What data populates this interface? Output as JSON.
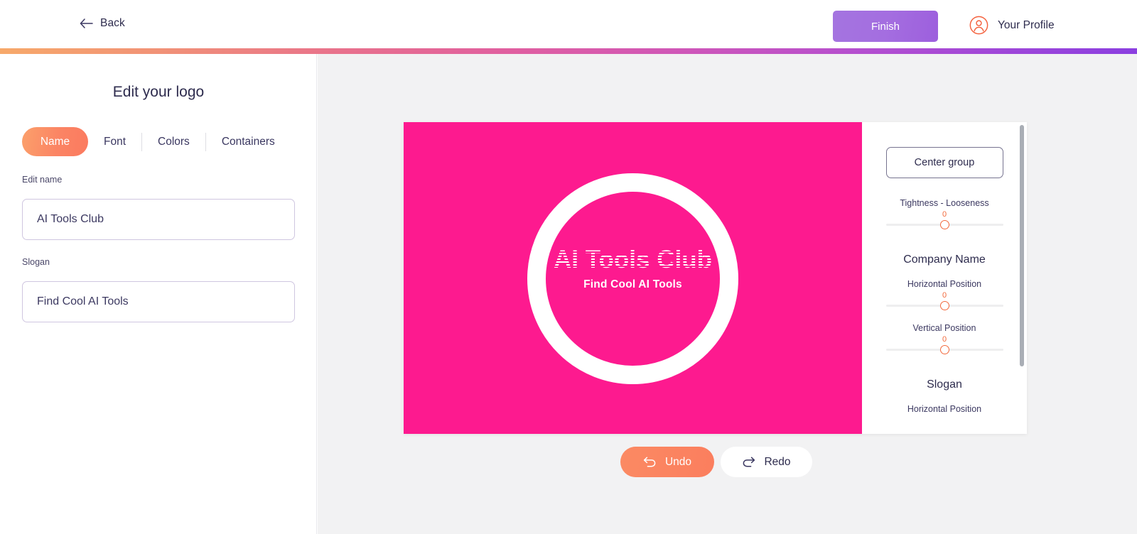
{
  "header": {
    "back_label": "Back",
    "back_icon": "arrow-left-icon",
    "finish_label": "Finish",
    "profile_label": "Your Profile",
    "profile_icon": "user-circle-icon",
    "accent_purple": "#a46ee0",
    "accent_orange": "#f2693c"
  },
  "sidebar": {
    "title": "Edit your logo",
    "tabs": [
      {
        "label": "Name",
        "active": true
      },
      {
        "label": "Font",
        "active": false
      },
      {
        "label": "Colors",
        "active": false
      },
      {
        "label": "Containers",
        "active": false
      }
    ],
    "fields": [
      {
        "label": "Edit name",
        "value": "AI Tools Club",
        "placeholder": "Enter your name"
      },
      {
        "label": "Slogan",
        "value": "Find Cool AI Tools",
        "placeholder": "Enter your slogan"
      }
    ]
  },
  "logo_preview": {
    "name": "AI Tools Club",
    "slogan": "Find Cool AI Tools",
    "background_color": "#fd1a8f",
    "ring_color": "#ffffff"
  },
  "controls": {
    "center_group_label": "Center group",
    "tightness_label": "Tightness - Looseness",
    "tightness_value": "0",
    "company_name_group": "Company Name",
    "company_horizontal_label": "Horizontal Position",
    "company_horizontal_value": "0",
    "company_vertical_label": "Vertical Position",
    "company_vertical_value": "0",
    "slogan_group": "Slogan",
    "slogan_horizontal_label": "Horizontal Position"
  },
  "actions": {
    "undo_label": "Undo",
    "undo_icon": "undo-arrow-icon",
    "redo_label": "Redo",
    "redo_icon": "redo-arrow-icon"
  }
}
